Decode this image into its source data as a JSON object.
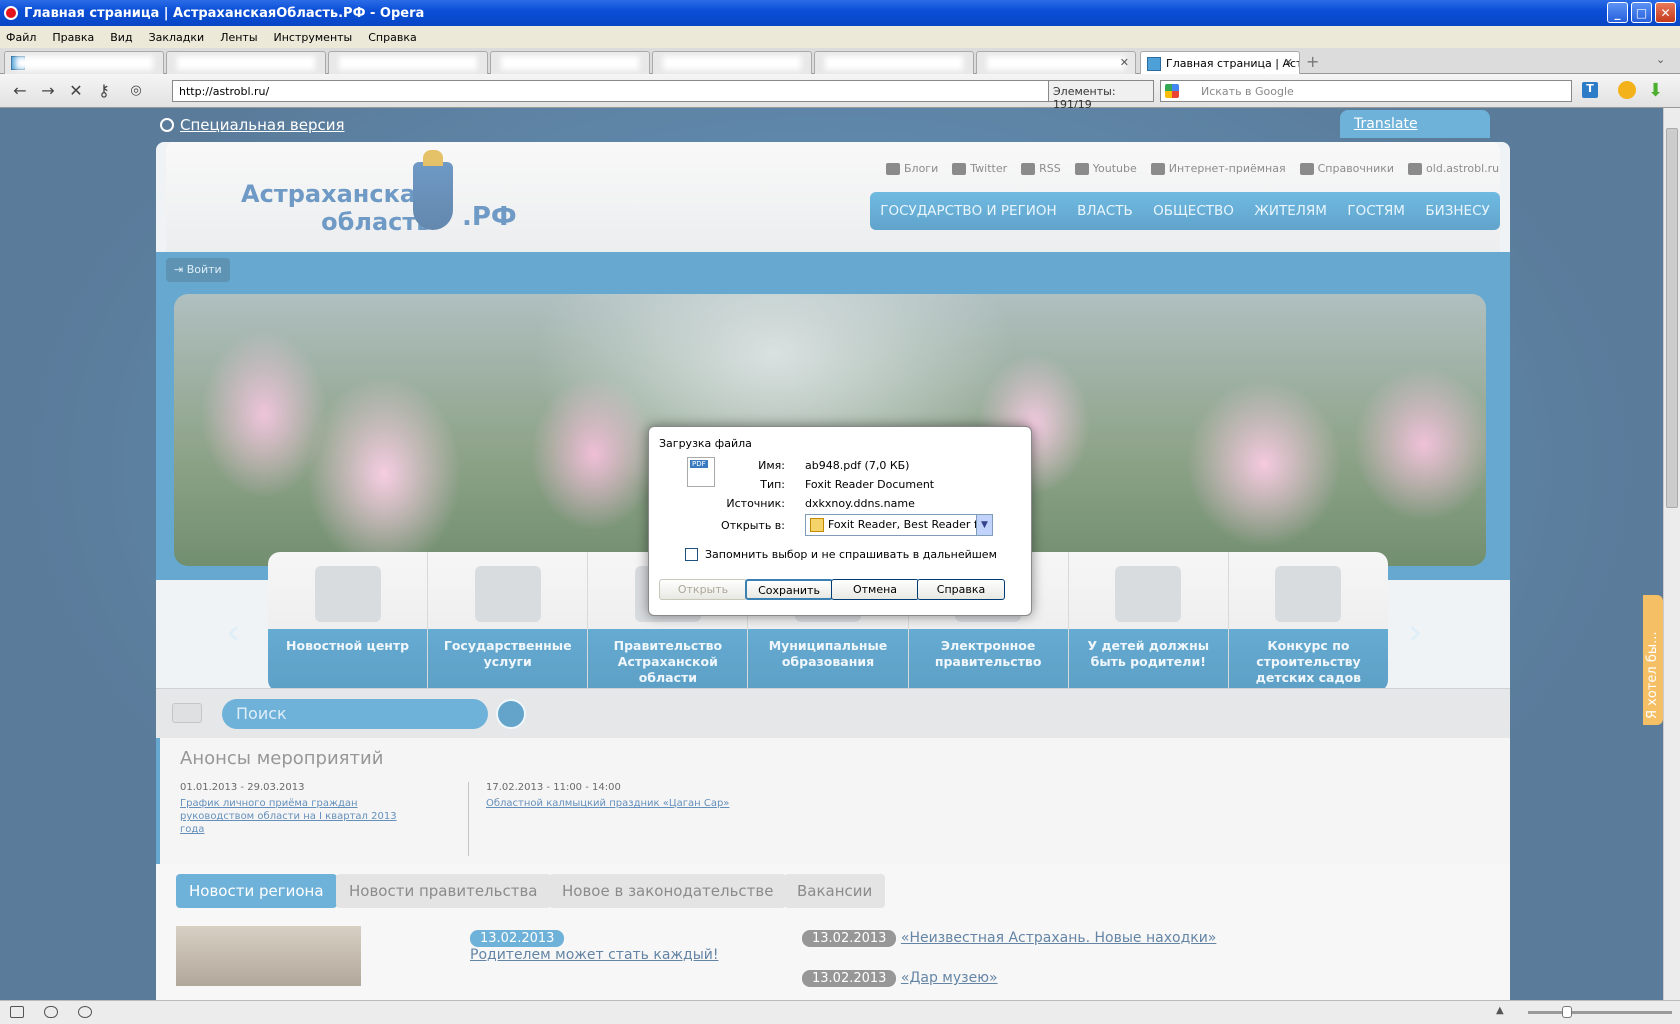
{
  "window": {
    "title": "Главная страница | АстраханскаяОбласть.РФ - Opera"
  },
  "menu": [
    "Файл",
    "Правка",
    "Вид",
    "Закладки",
    "Ленты",
    "Инструменты",
    "Справка"
  ],
  "tabs": {
    "active_label": "Главная страница | Аст..."
  },
  "address": {
    "url": "http://astrobl.ru/",
    "elements": "Элементы:  191/19",
    "search_placeholder": "Искать в Google"
  },
  "site": {
    "special_version": "Специальная версия",
    "translate": "Translate",
    "logo": {
      "line1": "Астраханская",
      "line2": "область",
      "suffix": ".РФ"
    },
    "social": [
      "Блоги",
      "Twitter",
      "RSS",
      "Youtube",
      "Интернет-приёмная",
      "Справочники",
      "old.astrobl.ru"
    ],
    "nav": [
      "ГОСУДАРСТВО И РЕГИОН",
      "ВЛАСТЬ",
      "ОБЩЕСТВО",
      "ЖИТЕЛЯМ",
      "ГОСТЯМ",
      "БИЗНЕСУ"
    ],
    "login": "Войти",
    "carousel": [
      "Новостной центр",
      "Государственные услуги",
      "Правительство Астраханской области",
      "Муниципальные образования",
      "Электронное правительство",
      "У детей должны быть родители!",
      "Конкурс по строительству детских садов"
    ],
    "search_placeholder": "Поиск",
    "announce": {
      "title": "Анонсы мероприятий",
      "events": [
        {
          "date": "01.01.2013 - 29.03.2013",
          "text": "График личного приёма граждан руководством области на I квартал 2013 года"
        },
        {
          "date": "17.02.2013 - 11:00 - 14:00",
          "text": "Областной калмыцкий праздник «Цаган Сар»"
        }
      ]
    },
    "news_tabs": [
      "Новости региона",
      "Новости правительства",
      "Новое в законодательстве",
      "Вакансии"
    ],
    "news": [
      {
        "date": "13.02.2013",
        "title": "Родителем может стать каждый!"
      },
      {
        "date": "13.02.2013",
        "title": "«Неизвестная Астрахань. Новые находки»"
      },
      {
        "date": "13.02.2013",
        "title": "«Дар музею»"
      }
    ],
    "side_tab": "Я хотел бы..."
  },
  "dialog": {
    "title": "Загрузка файла",
    "name_label": "Имя:",
    "name": "ab948.pdf (7,0 КБ)",
    "type_label": "Тип:",
    "type": "Foxit Reader Document",
    "source_label": "Источник:",
    "source": "dxkxnoy.ddns.name",
    "open_label": "Открыть в:",
    "open_with": "Foxit Reader, Best Reader for",
    "remember": "Запомнить выбор и не спрашивать в дальнейшем",
    "buttons": {
      "open": "Открыть",
      "save": "Сохранить",
      "cancel": "Отмена",
      "help": "Справка"
    }
  }
}
